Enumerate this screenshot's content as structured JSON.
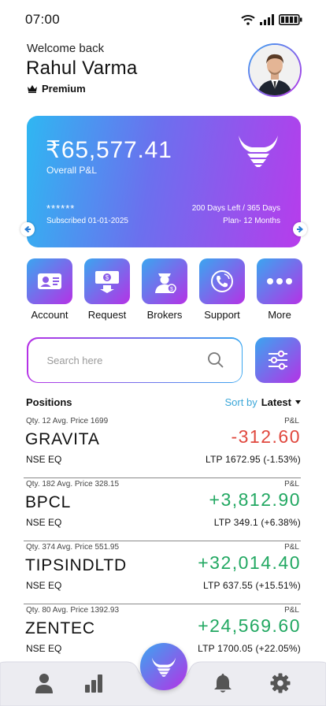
{
  "status_bar": {
    "time": "07:00"
  },
  "header": {
    "welcome": "Welcome back",
    "user_name": "Rahul Varma",
    "plan_badge": "Premium"
  },
  "summary_card": {
    "amount": "₹65,577.41",
    "amount_label": "Overall P&L",
    "masked": "******",
    "subscribed": "Subscribed 01-01-2025",
    "days_left": "200 Days Left / 365 Days",
    "plan_length": "Plan- 12 Months"
  },
  "quick_actions": [
    {
      "label": "Account",
      "icon": "account-card-icon"
    },
    {
      "label": "Request",
      "icon": "cash-request-icon"
    },
    {
      "label": "Brokers",
      "icon": "broker-icon"
    },
    {
      "label": "Support",
      "icon": "support-phone-icon"
    },
    {
      "label": "More",
      "icon": "more-dots-icon"
    }
  ],
  "search": {
    "placeholder": "Search here"
  },
  "positions": {
    "title": "Positions",
    "sort_label": "Sort by",
    "sort_value": "Latest",
    "pl_label": "P&L",
    "rows": [
      {
        "meta": "Qty. 12  Avg. Price 1699",
        "symbol": "GRAVITA",
        "exchange": "NSE EQ",
        "pnl": "-312.60",
        "ltp": "LTP 1672.95 (-1.53%)",
        "trend": "negative"
      },
      {
        "meta": "Qty. 182  Avg. Price 328.15",
        "symbol": "BPCL",
        "exchange": "NSE EQ",
        "pnl": "+3,812.90",
        "ltp": "LTP 349.1 (+6.38%)",
        "trend": "positive"
      },
      {
        "meta": "Qty. 374 Avg. Price 551.95",
        "symbol": "TIPSINDLTD",
        "exchange": "NSE EQ",
        "pnl": "+32,014.40",
        "ltp": "LTP 637.55 (+15.51%)",
        "trend": "positive"
      },
      {
        "meta": "Qty. 80 Avg. Price 1392.93",
        "symbol": "ZENTEC",
        "exchange": "NSE EQ",
        "pnl": "+24,569.60",
        "ltp": "LTP 1700.05 (+22.05%)",
        "trend": "positive"
      }
    ]
  },
  "bottom_nav": [
    "profile-icon",
    "chart-icon",
    "bull-logo-icon",
    "bell-icon",
    "settings-icon"
  ],
  "colors": {
    "gradient_start": "#2fb7f2",
    "gradient_end": "#b73cec",
    "positive": "#22a862",
    "negative": "#e0483e",
    "link": "#3aa6d8"
  }
}
